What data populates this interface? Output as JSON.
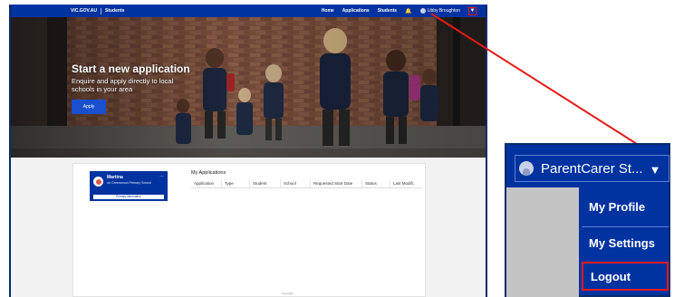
{
  "nav": {
    "brand": "VIC.GOV.AU",
    "section": "Students",
    "links": [
      "Home",
      "Applications",
      "Students"
    ],
    "user_name": "Libby Broughton"
  },
  "hero": {
    "title": "Start a new application",
    "subtitle": "Enquire and apply directly to local schools in your area",
    "apply_label": "Apply"
  },
  "profile_card": {
    "name": "Martina",
    "school": "on Greenwood Primary School",
    "bar_text": "Primary information"
  },
  "applications": {
    "title": "My Applications",
    "columns": [
      "Application",
      "Type",
      "Student",
      "School",
      "Requested Start Date",
      "Status",
      "Last Modifi.."
    ]
  },
  "footer": {
    "text": "Copyright"
  },
  "dropdown": {
    "user_label": "ParentCarer St...",
    "items": [
      "My Profile",
      "My Settings",
      "Logout"
    ]
  },
  "colors": {
    "brand_blue": "#0032a0",
    "highlight_red": "#e41b17"
  }
}
